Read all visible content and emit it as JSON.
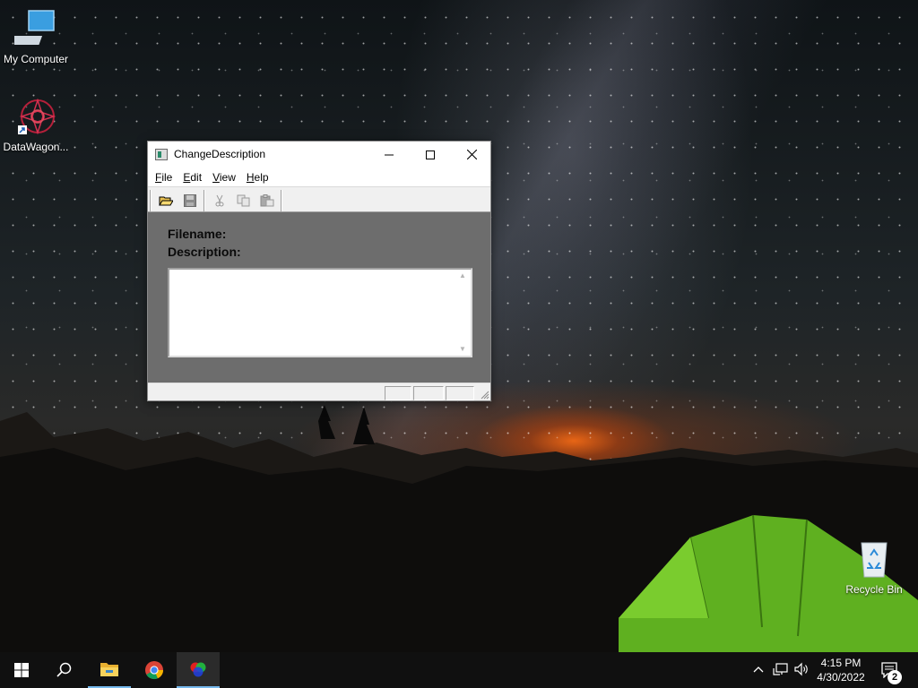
{
  "desktop": {
    "icons": [
      {
        "label": "My Computer",
        "icon": "computer-icon"
      },
      {
        "label": "DataWagon...",
        "icon": "datawagon-app-icon"
      },
      {
        "label": "Recycle Bin",
        "icon": "recycle-bin-icon"
      }
    ]
  },
  "window": {
    "title": "ChangeDescription",
    "menu": [
      {
        "label": "File",
        "underline": "F",
        "rest": "ile"
      },
      {
        "label": "Edit",
        "underline": "E",
        "rest": "dit"
      },
      {
        "label": "View",
        "underline": "V",
        "rest": "iew"
      },
      {
        "label": "Help",
        "underline": "H",
        "rest": "elp"
      }
    ],
    "toolbar": [
      "open-icon",
      "save-icon",
      "cut-icon",
      "copy-icon",
      "paste-icon"
    ],
    "filename_label": "Filename:",
    "description_label": "Description:",
    "description_value": ""
  },
  "taskbar": {
    "apps": [
      "start-icon",
      "search-icon",
      "file-explorer-icon",
      "chrome-icon",
      "colors-app-icon"
    ],
    "time": "4:15 PM",
    "date": "4/30/2022",
    "notification_count": "2"
  },
  "colors": {
    "client_background": "#6d6d6d",
    "taskbar": "#101010",
    "accent": "#76b9ed"
  }
}
